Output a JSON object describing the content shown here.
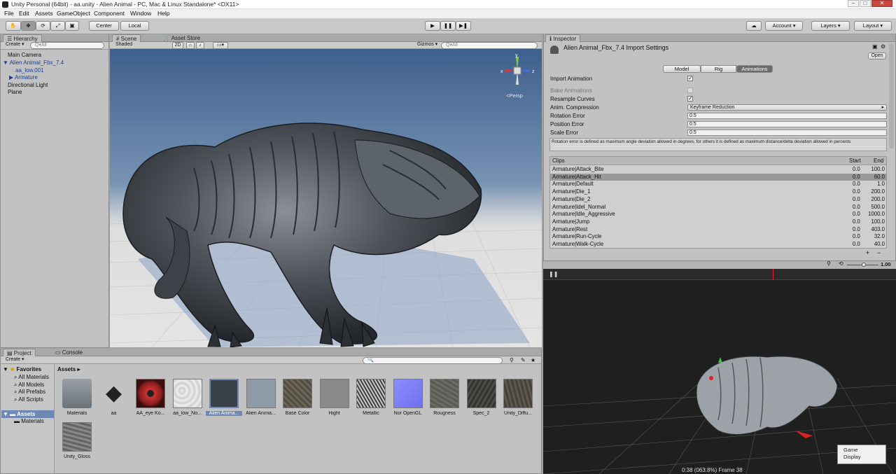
{
  "window": {
    "title": "Unity Personal (64bit) - aa.unity - Alien Animal - PC, Mac & Linux Standalone* <DX11>"
  },
  "menu": [
    "File",
    "Edit",
    "Assets",
    "GameObject",
    "Component",
    "Window",
    "Help"
  ],
  "toolbar": {
    "pivot": "Center",
    "space": "Local",
    "account": "Account",
    "layers": "Layers",
    "layout": "Layout"
  },
  "hierarchy": {
    "tab": "Hierarchy",
    "create": "Create",
    "search": "Q▾All",
    "items": [
      "Main Camera",
      "Alien Animal_Fbx_7.4",
      "aa_low.001",
      "Armature",
      "Directional Light",
      "Plane"
    ]
  },
  "scene": {
    "tab_scene": "Scene",
    "tab_store": "Asset Store",
    "shading": "Shaded",
    "mode2d": "2D",
    "gizmos": "Gizmos",
    "search": "Q▾All",
    "persp": "<Persp",
    "axis": {
      "x": "x",
      "y": "y",
      "z": "z"
    }
  },
  "inspector": {
    "tab": "Inspector",
    "title": "Alien Animal_Fbx_7.4 Import Settings",
    "open": "Open",
    "tabs": [
      "Model",
      "Rig",
      "Animations"
    ],
    "import_animation": "Import Animation",
    "bake_animations": "Bake Animations",
    "resample_curves": "Resample Curves",
    "anim_compression": "Anim. Compression",
    "anim_compression_value": "Keyframe Reduction",
    "rotation_error": "Rotation Error",
    "rotation_error_value": "0.5",
    "position_error": "Position Error",
    "position_error_value": "0.5",
    "scale_error": "Scale Error",
    "scale_error_value": "0.5",
    "help": "Rotation error is defined as maximum angle deviation allowed in degrees, for others it is defined as maximum distance/delta deviation allowed in percents",
    "clips_header": {
      "name": "Clips",
      "start": "Start",
      "end": "End"
    },
    "clips": [
      {
        "name": "Armature|Attack_Bite",
        "start": "0.0",
        "end": "100.0"
      },
      {
        "name": "Armature|Attack_Hit",
        "start": "0.0",
        "end": "60.0"
      },
      {
        "name": "Armature|Default",
        "start": "0.0",
        "end": "1.0"
      },
      {
        "name": "Armature|Die_1",
        "start": "0.0",
        "end": "200.0"
      },
      {
        "name": "Armature|Die_2",
        "start": "0.0",
        "end": "200.0"
      },
      {
        "name": "Armature|Idel_Normal",
        "start": "0.0",
        "end": "500.0"
      },
      {
        "name": "Armature|Idle_Aggressive",
        "start": "0.0",
        "end": "1000.0"
      },
      {
        "name": "Armature|Jump",
        "start": "0.0",
        "end": "100.0"
      },
      {
        "name": "Armature|Rest",
        "start": "0.0",
        "end": "403.0"
      },
      {
        "name": "Armature|Run-Cycle",
        "start": "0.0",
        "end": "32.0"
      },
      {
        "name": "Armature|Walk-Cycle",
        "start": "0.0",
        "end": "40.0"
      }
    ],
    "selected_clip": 1,
    "plus": "+",
    "minus": "−",
    "speed": "1.00"
  },
  "preview": {
    "status": "0:38 (063.8%) Frame 38",
    "game": "Game",
    "display": "Display"
  },
  "project": {
    "tab_project": "Project",
    "tab_console": "Console",
    "create": "Create",
    "favorites": "Favorites",
    "fav_items": [
      "All Materials",
      "All Models",
      "All Prefabs",
      "All Scripts"
    ],
    "assets_root": "Assets",
    "assets_children": [
      "Materials"
    ],
    "breadcrumb": "Assets ▸",
    "assets": [
      "Materials",
      "aa",
      "AA_eye Ko...",
      "aa_low_No...",
      "Alien Anima...",
      "Alien Anima...",
      "Base Color",
      "Hight",
      "Metallic",
      "Nor OpenGL",
      "Rougness",
      "Spec_2",
      "Unity_Diffu...",
      "Unity_Gloss"
    ]
  }
}
